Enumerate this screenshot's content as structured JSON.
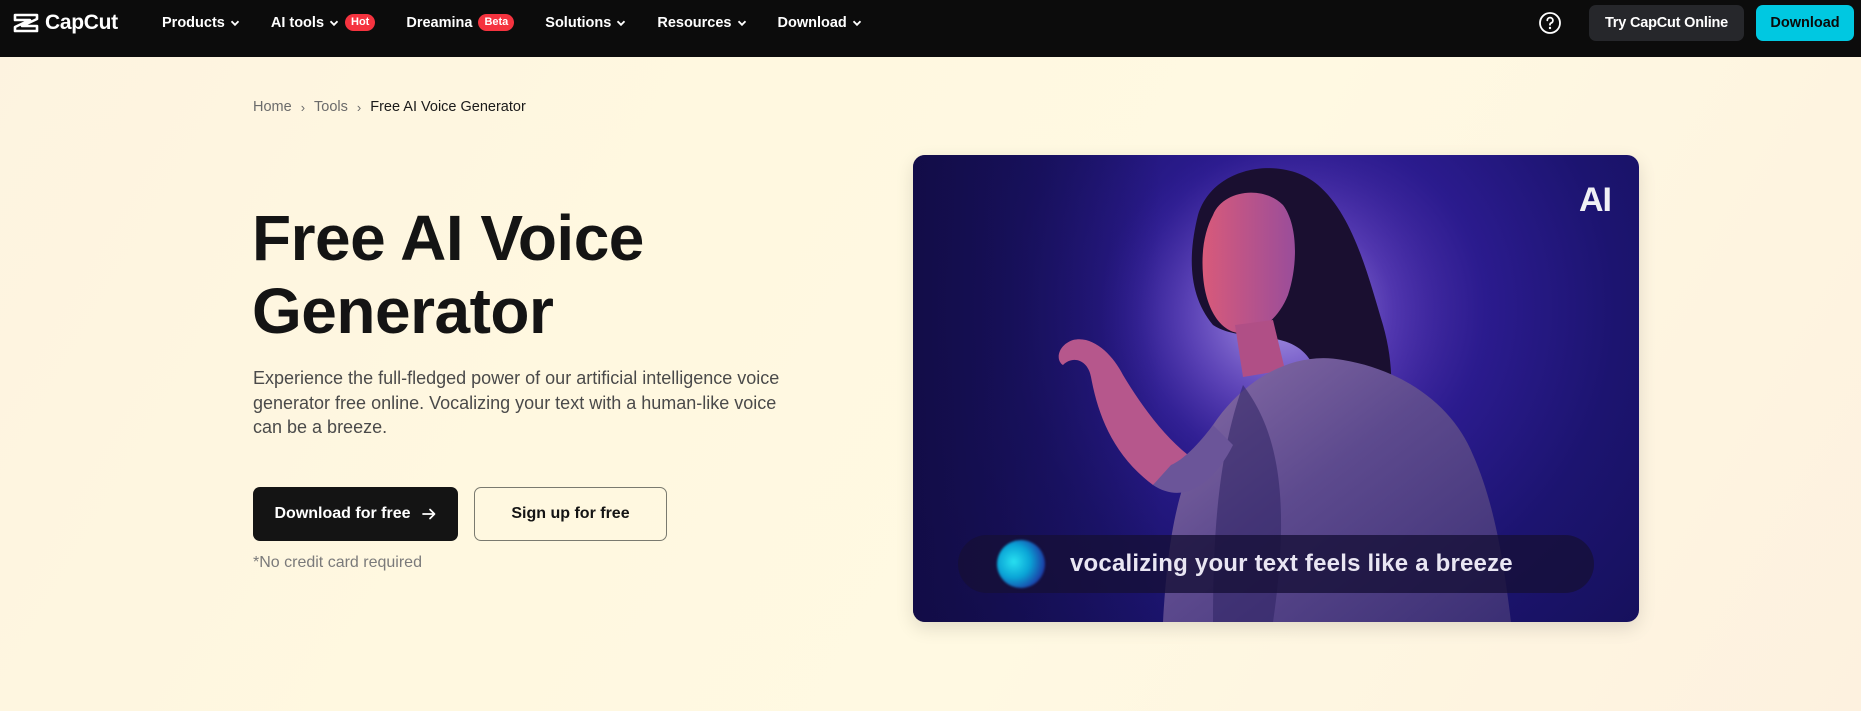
{
  "brand": {
    "name": "CapCut"
  },
  "nav": {
    "items": [
      {
        "label": "Products",
        "has_chevron": true
      },
      {
        "label": "AI tools",
        "has_chevron": true,
        "badge": "Hot"
      },
      {
        "label": "Dreamina",
        "has_chevron": false,
        "badge": "Beta"
      },
      {
        "label": "Solutions",
        "has_chevron": true
      },
      {
        "label": "Resources",
        "has_chevron": true
      },
      {
        "label": "Download",
        "has_chevron": true
      }
    ],
    "try_online_label": "Try CapCut Online",
    "download_label": "Download"
  },
  "breadcrumb": {
    "items": [
      "Home",
      "Tools"
    ],
    "current": "Free AI Voice Generator"
  },
  "hero": {
    "title_line1": "Free AI Voice",
    "title_line2": "Generator",
    "description": "Experience the full-fledged power of our artificial intelligence voice generator free online. Vocalizing your text with a human-like voice can be a breeze.",
    "primary_button": "Download for free",
    "secondary_button": "Sign up for free",
    "note": "*No credit card required"
  },
  "media": {
    "badge": "AI",
    "caption": "vocalizing your text feels like a breeze"
  },
  "colors": {
    "nav_bg": "#0c0c0c",
    "accent": "#00c8e1",
    "badge_red": "#f5333f",
    "primary_button": "#141414"
  },
  "icons": [
    "capcut-logo-icon",
    "chevron-down-icon",
    "help-circle-icon",
    "arrow-right-icon"
  ]
}
